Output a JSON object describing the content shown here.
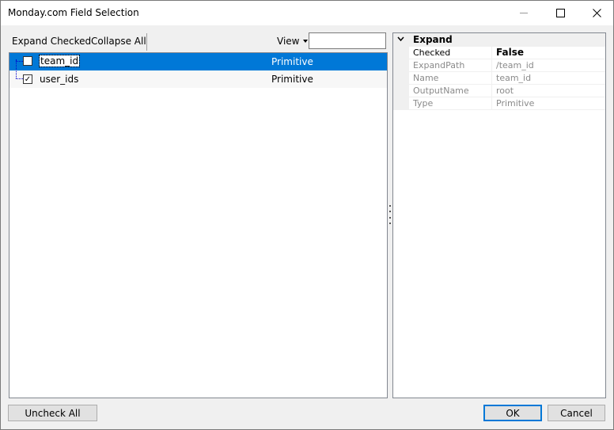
{
  "window": {
    "title": "Monday.com Field Selection"
  },
  "toolbar": {
    "expand_checked": "Expand Checked",
    "collapse_all": "Collapse All",
    "view_label": "View",
    "view_input_value": ""
  },
  "tree": {
    "rows": [
      {
        "name": "team_id",
        "type": "Primitive",
        "checked": false,
        "selected": true
      },
      {
        "name": "user_ids",
        "type": "Primitive",
        "checked": true,
        "selected": false
      }
    ]
  },
  "properties": {
    "category": "Expand",
    "rows": [
      {
        "key": "Checked",
        "value": "False"
      },
      {
        "key": "ExpandPath",
        "value": "/team_id"
      },
      {
        "key": "Name",
        "value": "team_id"
      },
      {
        "key": "OutputName",
        "value": "root"
      },
      {
        "key": "Type",
        "value": "Primitive"
      }
    ]
  },
  "buttons": {
    "uncheck_all": "Uncheck All",
    "ok": "OK",
    "cancel": "Cancel"
  },
  "colors": {
    "selection": "#0078d7",
    "default_button_border": "#0078d7"
  }
}
